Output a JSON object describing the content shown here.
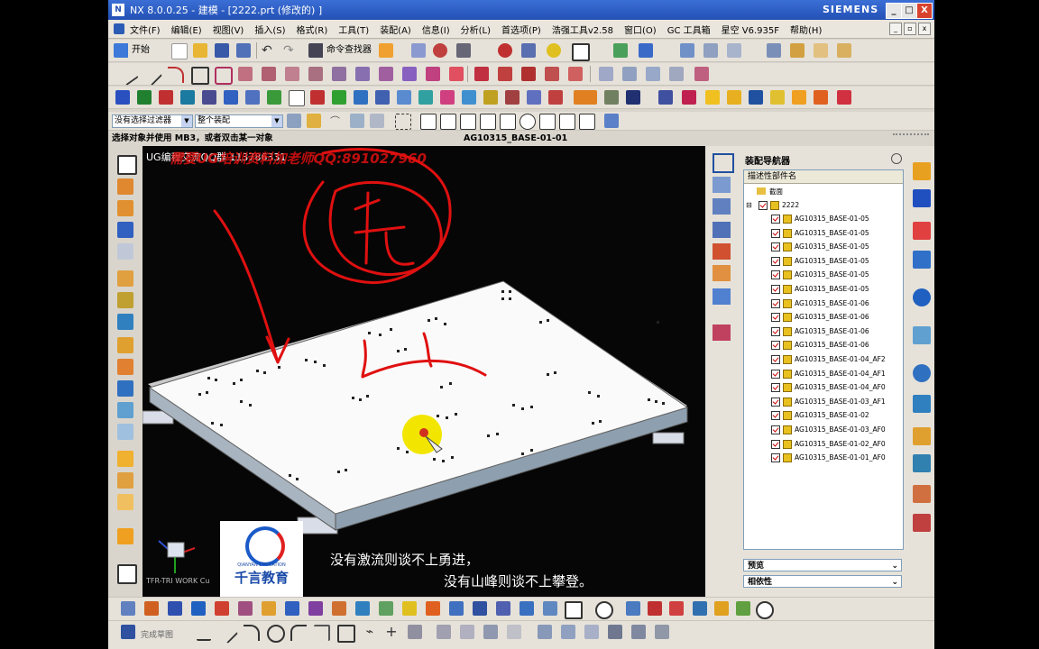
{
  "window": {
    "title": "NX 8.0.0.25 - 建模 - [2222.prt  (修改的) ]",
    "brand": "SIEMENS",
    "controls": [
      "_",
      "□",
      "X"
    ]
  },
  "menu": [
    {
      "name": "file",
      "label": "文件(F)"
    },
    {
      "name": "edit",
      "label": "编辑(E)"
    },
    {
      "name": "view",
      "label": "视图(V)"
    },
    {
      "name": "insert",
      "label": "插入(S)"
    },
    {
      "name": "format",
      "label": "格式(R)"
    },
    {
      "name": "tools",
      "label": "工具(T)"
    },
    {
      "name": "assembly",
      "label": "装配(A)"
    },
    {
      "name": "info",
      "label": "信息(I)"
    },
    {
      "name": "analysis",
      "label": "分析(L)"
    },
    {
      "name": "preferences",
      "label": "首选项(P)"
    },
    {
      "name": "haoxiang",
      "label": "浩强工具v2.58"
    },
    {
      "name": "window",
      "label": "窗口(O)"
    },
    {
      "name": "gc",
      "label": "GC 工具箱"
    },
    {
      "name": "xingkong",
      "label": "星空 V6.935F"
    },
    {
      "name": "help",
      "label": "帮助(H)"
    }
  ],
  "toolbar1": {
    "start_label": "开始",
    "command_finder_label": "命令查找器"
  },
  "filterbar": {
    "filter_value": "没有选择过滤器",
    "scope_value": "整个装配"
  },
  "status": {
    "prompt": "选择对象并使用 MB3，或者双击某一对象",
    "part_name": "AG10315_BASE-01-01"
  },
  "viewport": {
    "overlay_title": "UG编程交流QQ群 113786331",
    "overlay_red": "需要UG培训资料加老师QQ:891027960",
    "handwriting": "先",
    "triad_label": "TFR-TRI WORK Cu",
    "logo_text": "千言教育",
    "logo_sub": "QIANYAN EDUCATION",
    "subtitle_line1": "没有激流则谈不上勇进，",
    "subtitle_line2": "没有山峰则谈不上攀登。"
  },
  "navigator": {
    "title": "装配导航器",
    "column_header": "描述性部件名",
    "section_folder": "截面",
    "root": "2222",
    "items": [
      "AG10315_BASE-01-05",
      "AG10315_BASE-01-05",
      "AG10315_BASE-01-05",
      "AG10315_BASE-01-05",
      "AG10315_BASE-01-05",
      "AG10315_BASE-01-05",
      "AG10315_BASE-01-06",
      "AG10315_BASE-01-06",
      "AG10315_BASE-01-06",
      "AG10315_BASE-01-06",
      "AG10315_BASE-01-04_AF2",
      "AG10315_BASE-01-04_AF1",
      "AG10315_BASE-01-04_AF0",
      "AG10315_BASE-01-03_AF1",
      "AG10315_BASE-01-02",
      "AG10315_BASE-01-03_AF0",
      "AG10315_BASE-01-02_AF0",
      "AG10315_BASE-01-01_AF0"
    ],
    "preview_label": "预览",
    "dependency_label": "相依性"
  },
  "bottom": {
    "sketch_label": "完成草图"
  },
  "colors": {
    "title_blue": "#2350b4",
    "annotation_red": "#e01010",
    "highlight_yellow": "#f2e600"
  }
}
